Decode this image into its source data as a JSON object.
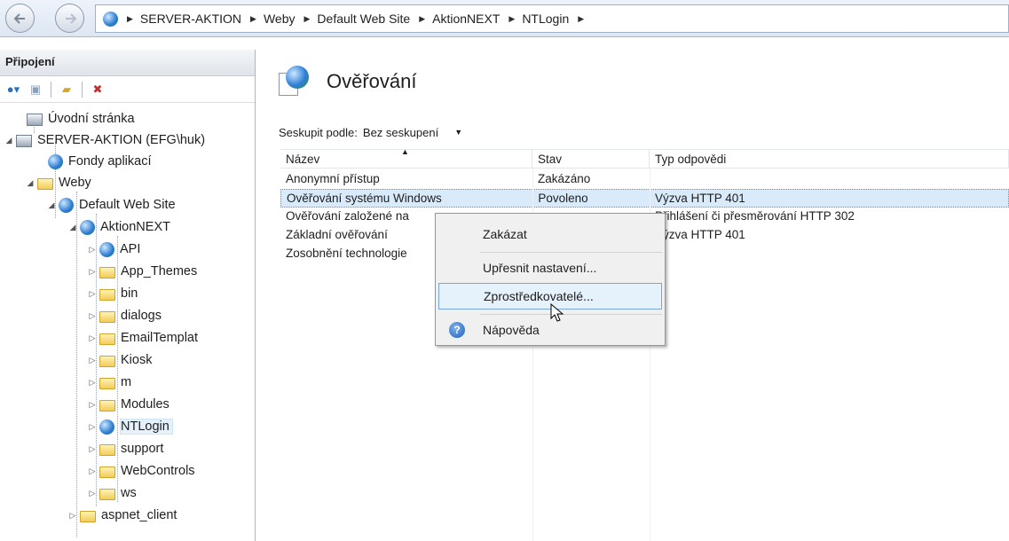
{
  "address": {
    "crumbs": [
      "SERVER-AKTION",
      "Weby",
      "Default Web Site",
      "AktionNEXT",
      "NTLogin"
    ]
  },
  "connections": {
    "header": "Připojení",
    "tree": [
      {
        "label": "Úvodní stránka",
        "icon": "start-page-icon"
      },
      {
        "label": "SERVER-AKTION (EFG\\huk)",
        "icon": "server-icon"
      },
      {
        "label": "Fondy aplikací",
        "icon": "app-pool-icon"
      },
      {
        "label": "Weby",
        "icon": "sites-folder-icon"
      },
      {
        "label": "Default Web Site",
        "icon": "globe-icon"
      },
      {
        "label": "AktionNEXT",
        "icon": "web-app-icon"
      },
      {
        "label": "API",
        "icon": "web-app-icon"
      },
      {
        "label": "App_Themes",
        "icon": "folder-icon"
      },
      {
        "label": "bin",
        "icon": "folder-icon"
      },
      {
        "label": "dialogs",
        "icon": "folder-icon"
      },
      {
        "label": "EmailTemplat",
        "icon": "folder-icon"
      },
      {
        "label": "Kiosk",
        "icon": "folder-icon"
      },
      {
        "label": "m",
        "icon": "folder-icon"
      },
      {
        "label": "Modules",
        "icon": "folder-icon"
      },
      {
        "label": "NTLogin",
        "icon": "web-app-icon"
      },
      {
        "label": "support",
        "icon": "folder-icon"
      },
      {
        "label": "WebControls",
        "icon": "folder-icon"
      },
      {
        "label": "ws",
        "icon": "folder-icon"
      },
      {
        "label": "aspnet_client",
        "icon": "folder-icon"
      }
    ]
  },
  "main": {
    "title": "Ověřování",
    "group_label": "Seskupit podle:",
    "group_value": "Bez seskupení",
    "columns": [
      "Název",
      "Stav",
      "Typ odpovědi"
    ],
    "rows": [
      {
        "name": "Anonymní přístup",
        "status": "Zakázáno",
        "response": ""
      },
      {
        "name": "Ověřování systému Windows",
        "status": "Povoleno",
        "response": "Výzva HTTP 401"
      },
      {
        "name": "Ověřování založené na",
        "status": "",
        "response": "Přihlášení či přesměrování HTTP 302"
      },
      {
        "name": "Základní ověřování",
        "status": "",
        "response": "Výzva HTTP 401"
      },
      {
        "name": "Zosobnění technologie",
        "status": "",
        "response": ""
      }
    ]
  },
  "context_menu": {
    "items": [
      "Zakázat",
      "Upřesnit nastavení...",
      "Zprostředkovatelé...",
      "Nápověda"
    ]
  },
  "colors": {
    "selection": "#d9ebfb",
    "accent": "#7aa6d8"
  }
}
